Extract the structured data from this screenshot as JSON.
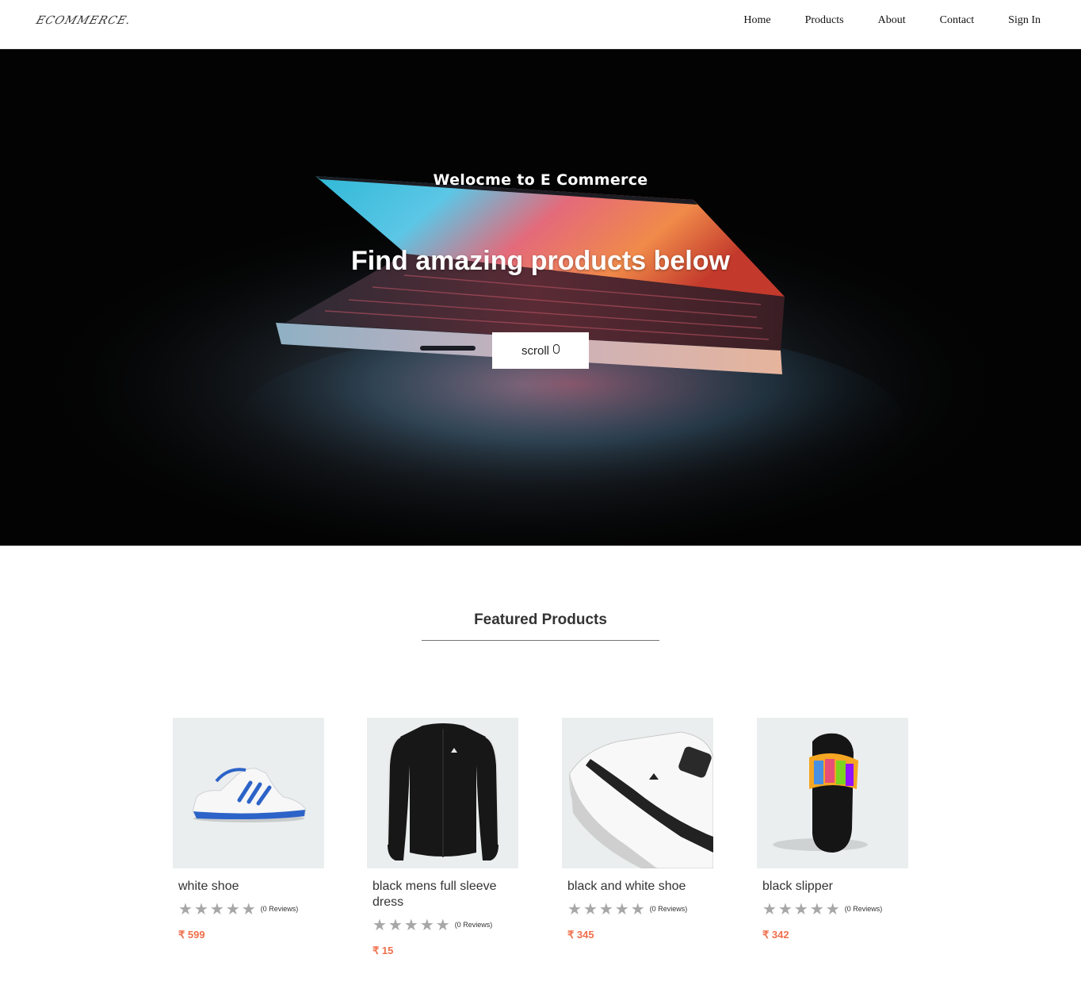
{
  "header": {
    "logo": "ECOMMERCE.",
    "nav": [
      "Home",
      "Products",
      "About",
      "Contact",
      "Sign In"
    ]
  },
  "hero": {
    "subtitle": "Welocme to E Commerce",
    "title": "Find amazing products below",
    "scroll_label": "scroll"
  },
  "featured": {
    "title": "Featured Products"
  },
  "products": [
    {
      "name": "white shoe",
      "reviews": "(0 Reviews)",
      "price": "₹ 599",
      "rating": 0
    },
    {
      "name": "black mens full sleeve dress",
      "reviews": "(0 Reviews)",
      "price": "₹ 15",
      "rating": 0
    },
    {
      "name": "black and white shoe",
      "reviews": "(0 Reviews)",
      "price": "₹ 345",
      "rating": 0
    },
    {
      "name": "black slipper",
      "reviews": "(0 Reviews)",
      "price": "₹ 342",
      "rating": 0
    }
  ],
  "colors": {
    "price": "#f16f4b",
    "star_empty": "#a7a7a7",
    "card_bg": "#ebeeee",
    "hero_bg": "#030303"
  },
  "icons": {
    "scroll": "mouse-icon",
    "star": "star-icon"
  }
}
